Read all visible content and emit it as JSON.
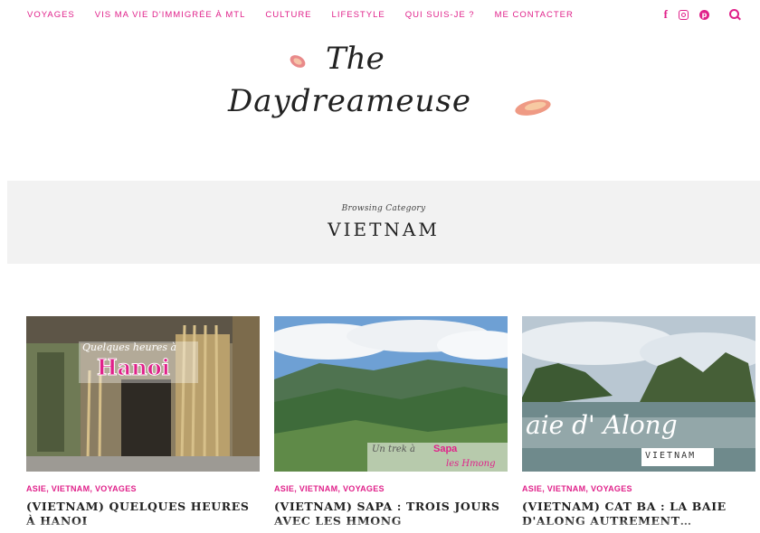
{
  "nav": {
    "items": [
      "VOYAGES",
      "VIS MA VIE D'IMMIGRÉE À MTL",
      "CULTURE",
      "LIFESTYLE",
      "QUI SUIS-JE ?",
      "ME CONTACTER"
    ],
    "social_icons": [
      "facebook-icon",
      "instagram-icon",
      "pinterest-icon"
    ],
    "search_icon": "search-icon"
  },
  "logo": {
    "line1": "The",
    "line2": "Daydreameuse"
  },
  "category": {
    "browsing_label": "Browsing Category",
    "title": "VIETNAM"
  },
  "posts": [
    {
      "categories": "ASIE, VIETNAM, VOYAGES",
      "title": "(VIETNAM) QUELQUES HEURES À HANOI",
      "overlay_top": "Quelques heures à",
      "overlay_main": "Hanoi"
    },
    {
      "categories": "ASIE, VIETNAM, VOYAGES",
      "title": "(VIETNAM) SAPA : TROIS JOURS AVEC LES HMONG",
      "overlay_text": "Un trek à",
      "overlay_pink": "Sapa",
      "overlay_sub": "les Hmong"
    },
    {
      "categories": "ASIE, VIETNAM, VOYAGES",
      "title": "(VIETNAM) CAT BA : LA BAIE D'ALONG AUTREMENT…",
      "overlay_main": "aie d' Along",
      "overlay_tag": "VIETNAM"
    }
  ],
  "colors": {
    "accent": "#e0218a",
    "banner_bg": "#f2f2f2",
    "text": "#222222"
  }
}
